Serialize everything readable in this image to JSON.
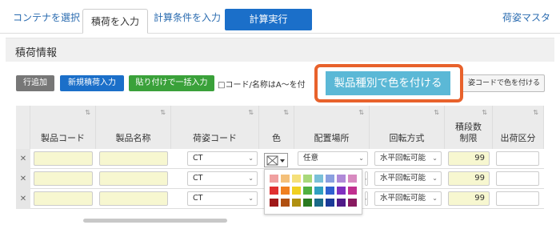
{
  "nav": {
    "tabs": [
      "コンテナを選択",
      "積荷を入力",
      "計算条件を入力"
    ],
    "run": "計算実行",
    "right": "荷姿マスタ"
  },
  "section_title": "積荷情報",
  "toolbar": {
    "add_row": "行追加",
    "new_cargo": "新規積荷入力",
    "paste": "貼り付けで一括入力",
    "checkbox_label": "□コード/名称はA〜を付",
    "color_by_product": "製品種別で色を付ける",
    "color_by_code": "姿コードで色を付ける"
  },
  "columns": [
    "製品コード",
    "製品名称",
    "荷姿コード",
    "色",
    "配置場所",
    "回転方式",
    "積段数\n制限",
    "出荷区分"
  ],
  "rows": [
    {
      "pack": "CT",
      "place": "任意",
      "rotate": "水平回転可能",
      "stack": "99"
    },
    {
      "pack": "CT",
      "place": "",
      "rotate": "水平回転可能",
      "stack": "99"
    },
    {
      "pack": "CT",
      "place": "",
      "rotate": "水平回転可能",
      "stack": "99"
    }
  ],
  "colors": {
    "accent": "#1b6fc9",
    "add_row_btn": "#777777",
    "new_cargo_btn": "#1b6fc9",
    "paste_btn": "#3aa13a",
    "callout_border": "#e8622c",
    "callout_fill": "#5bb8d6"
  },
  "palette": [
    [
      "#f0a0a0",
      "#f4c07a",
      "#f5e07a",
      "#a8d87a",
      "#7ac0d8",
      "#8aa0e0",
      "#b08ad8",
      "#d88ac0"
    ],
    [
      "#e03030",
      "#f08020",
      "#f0d020",
      "#50b040",
      "#30a0c0",
      "#3060d0",
      "#8030c0",
      "#c03090"
    ],
    [
      "#a01818",
      "#b05010",
      "#b09010",
      "#2a7a20",
      "#1a6a88",
      "#1a3a98",
      "#501a88",
      "#881a60"
    ]
  ]
}
